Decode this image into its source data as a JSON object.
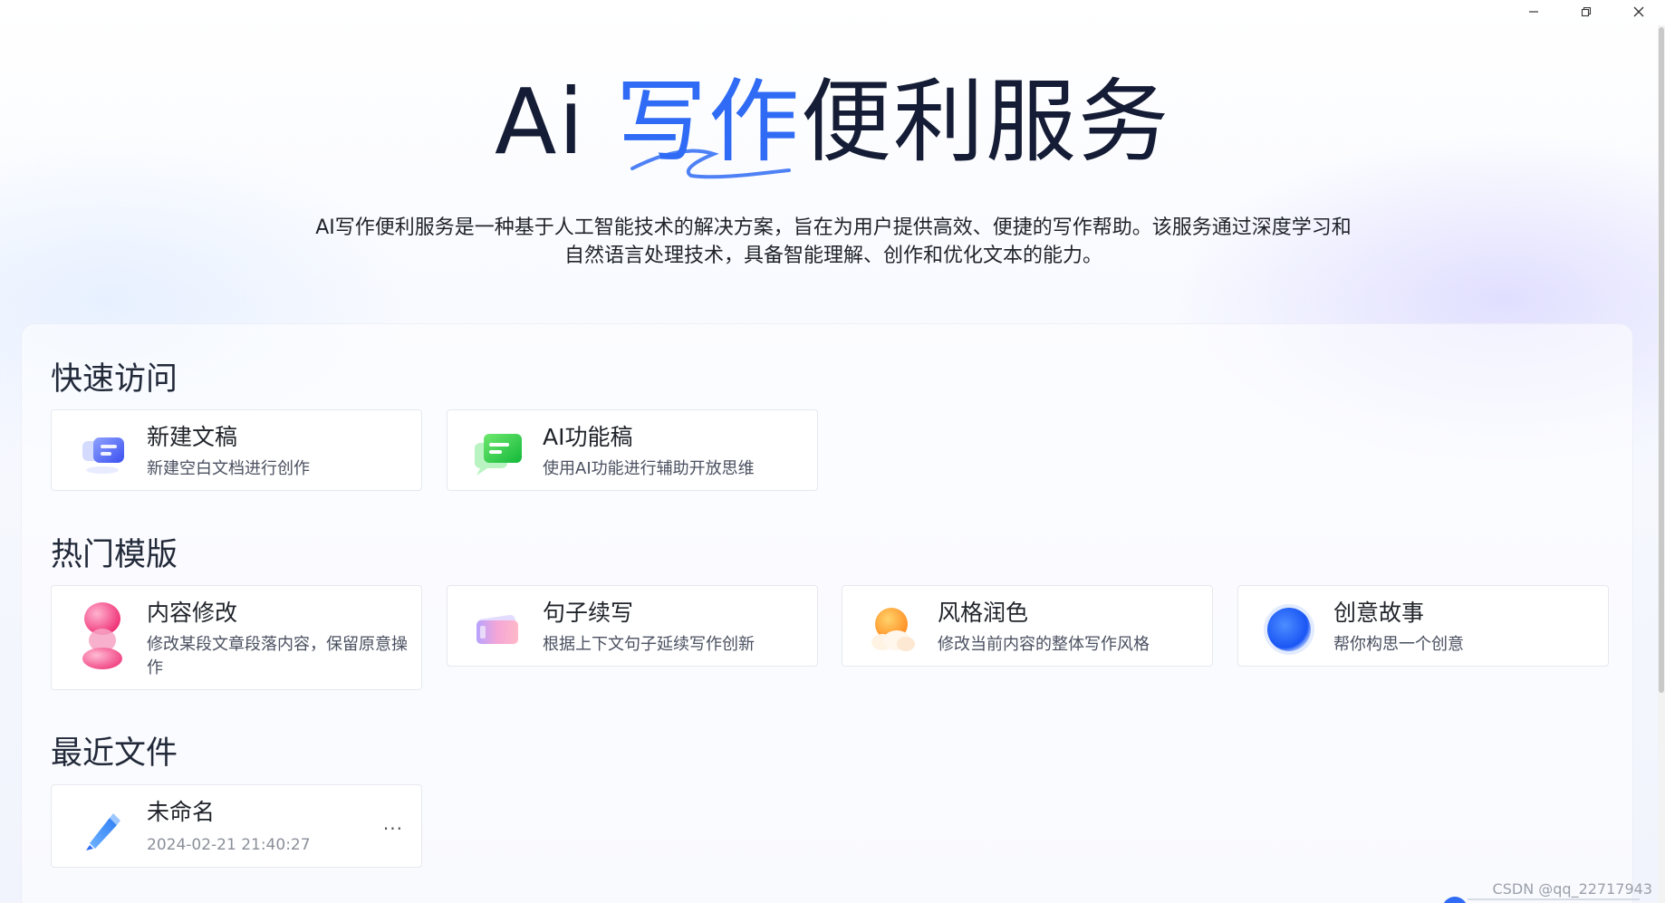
{
  "window": {
    "minimize_label": "minimize",
    "maximize_label": "restore",
    "close_label": "close"
  },
  "hero": {
    "title_prefix": "Ai ",
    "title_accent": "写作",
    "title_suffix": "便利服务",
    "description": "AI写作便利服务是一种基于人工智能技术的解决方案，旨在为用户提供高效、便捷的写作帮助。该服务通过深度学习和自然语言处理技术，具备智能理解、创作和优化文本的能力。"
  },
  "quick_access": {
    "title": "快速访问",
    "items": [
      {
        "title": "新建文稿",
        "subtitle": "新建空白文档进行创作",
        "icon": "new-doc-icon"
      },
      {
        "title": "AI功能稿",
        "subtitle": "使用AI功能进行辅助开放思维",
        "icon": "ai-chat-icon"
      }
    ]
  },
  "templates": {
    "title": "热门模版",
    "items": [
      {
        "title": "内容修改",
        "subtitle": "修改某段文章段落内容，保留原意操作",
        "icon": "pink-blob-icon"
      },
      {
        "title": "句子续写",
        "subtitle": "根据上下文句子延续写作创新",
        "icon": "gradient-card-icon"
      },
      {
        "title": "风格润色",
        "subtitle": "修改当前内容的整体写作风格",
        "icon": "sun-cloud-icon"
      },
      {
        "title": "创意故事",
        "subtitle": "帮你构思一个创意",
        "icon": "blue-orb-icon"
      }
    ]
  },
  "recent": {
    "title": "最近文件",
    "items": [
      {
        "title": "未命名",
        "date": "2024-02-21 21:40:27",
        "more": "...",
        "icon": "pencil-icon"
      }
    ]
  },
  "watermark": "CSDN @qq_22717943",
  "colors": {
    "accent": "#2f6bf4",
    "title": "#151c35"
  }
}
